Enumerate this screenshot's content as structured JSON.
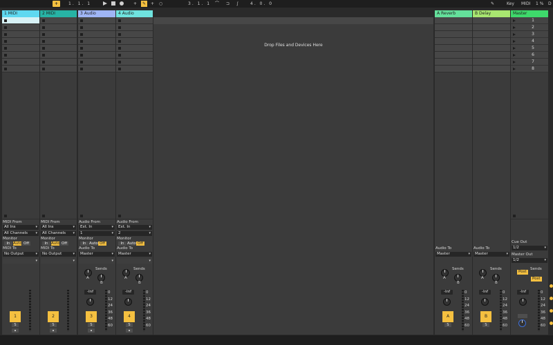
{
  "transport": {
    "metronome_label": "+",
    "arrangement_position": "1. 1. 1",
    "plus_label": "+",
    "misc_labels": [
      "+",
      "○"
    ],
    "loop_position": "3. 1. 1",
    "loop_length": "4. 0. 0",
    "key_label": "Key",
    "midi_label": "MIDI",
    "cpu_label": "1 %",
    "d_label": "D"
  },
  "tracks": [
    {
      "name": "1 MIDI",
      "number": "1",
      "color": "#5fd8f0",
      "type": "midi",
      "in_label": "MIDI From",
      "in_source": "All Ins",
      "in_channel": "All Channels",
      "monitor_label": "Monitor",
      "monitor_options": [
        "In",
        "Auto",
        "Off"
      ],
      "monitor_selected": "Auto",
      "out_label": "MIDI To",
      "out_target": "No Output"
    },
    {
      "name": "2 MIDI",
      "number": "2",
      "color": "#27b3a5",
      "type": "midi",
      "in_label": "MIDI From",
      "in_source": "All Ins",
      "in_channel": "All Channels",
      "monitor_label": "Monitor",
      "monitor_options": [
        "In",
        "Auto",
        "Off"
      ],
      "monitor_selected": "Auto",
      "out_label": "MIDI To",
      "out_target": "No Output"
    },
    {
      "name": "3 Audio",
      "number": "3",
      "color": "#9fb5f5",
      "type": "audio",
      "in_label": "Audio From",
      "in_source": "Ext. In",
      "in_channel": "1",
      "monitor_label": "Monitor",
      "monitor_options": [
        "In",
        "Auto",
        "Off"
      ],
      "monitor_selected": "Off",
      "out_label": "Audio To",
      "out_target": "Master",
      "sends_label": "Sends",
      "send_a": "A",
      "send_b": "B",
      "volume": "-Inf"
    },
    {
      "name": "4 Audio",
      "number": "4",
      "color": "#6fe3df",
      "type": "audio",
      "in_label": "Audio From",
      "in_source": "Ext. In",
      "in_channel": "2",
      "monitor_label": "Monitor",
      "monitor_options": [
        "In",
        "Auto",
        "Off"
      ],
      "monitor_selected": "Off",
      "out_label": "Audio To",
      "out_target": "Master",
      "sends_label": "Sends",
      "send_a": "A",
      "send_b": "B",
      "volume": "-Inf"
    }
  ],
  "returns": [
    {
      "name": "A Reverb",
      "letter": "A",
      "color": "#64e09b",
      "out_label": "Audio To",
      "out_target": "Master",
      "sends_label": "Sends",
      "send_a": "A",
      "send_b": "B",
      "volume": "-Inf"
    },
    {
      "name": "B Delay",
      "letter": "B",
      "color": "#a8e670",
      "out_label": "Audio To",
      "out_target": "Master",
      "sends_label": "Sends",
      "send_a": "A",
      "send_b": "B",
      "volume": "-Inf"
    }
  ],
  "master": {
    "name": "Master",
    "color": "#3ed96b",
    "scenes": [
      "1",
      "2",
      "3",
      "4",
      "5",
      "6",
      "7",
      "8"
    ],
    "cue_label": "Cue Out",
    "cue_target": "1/2",
    "out_label": "Master Out",
    "out_target": "1/2",
    "sends_label": "Sends",
    "post_label": "Post",
    "volume": "-Inf"
  },
  "solo_label": "S",
  "meter_scale": [
    "0",
    "12",
    "24",
    "36",
    "48",
    "60"
  ],
  "drop_hint": "Drop Files and Devices Here"
}
